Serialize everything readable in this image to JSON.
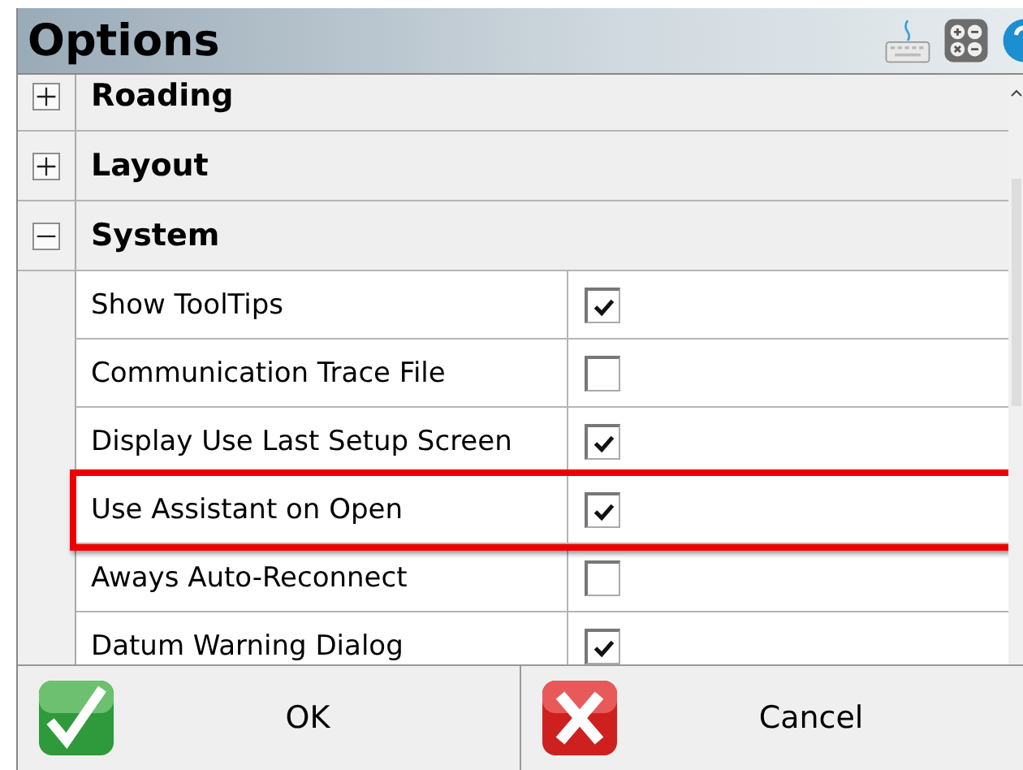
{
  "window": {
    "title": "Options"
  },
  "groups": [
    {
      "label": "Roading",
      "expanded": false
    },
    {
      "label": "Layout",
      "expanded": false
    },
    {
      "label": "System",
      "expanded": true,
      "children": [
        {
          "label": "Show ToolTips",
          "checked": true,
          "highlighted": false
        },
        {
          "label": "Communication Trace File",
          "checked": false,
          "highlighted": false
        },
        {
          "label": "Display Use Last Setup Screen",
          "checked": true,
          "highlighted": false
        },
        {
          "label": "Use Assistant on Open",
          "checked": true,
          "highlighted": true
        },
        {
          "label": "Aways Auto-Reconnect",
          "checked": false,
          "highlighted": false
        },
        {
          "label": "Datum Warning Dialog",
          "checked": true,
          "highlighted": false
        }
      ]
    }
  ],
  "buttons": [
    {
      "kind": "ok",
      "label": "OK"
    },
    {
      "kind": "cancel",
      "label": "Cancel"
    }
  ]
}
